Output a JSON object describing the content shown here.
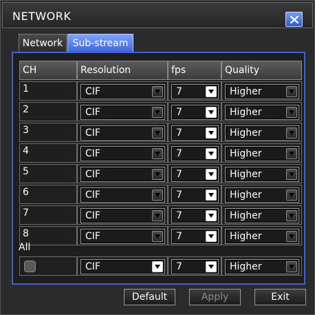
{
  "window": {
    "title": "NETWORK"
  },
  "tabs": [
    {
      "label": "Network",
      "active": false
    },
    {
      "label": "Sub-stream",
      "active": true
    }
  ],
  "table": {
    "headers": [
      "CH",
      "Resolution",
      "fps",
      "Quality"
    ],
    "rows": [
      {
        "ch": "1",
        "resolution": "CIF",
        "fps": "7",
        "quality": "Higher"
      },
      {
        "ch": "2",
        "resolution": "CIF",
        "fps": "7",
        "quality": "Higher"
      },
      {
        "ch": "3",
        "resolution": "CIF",
        "fps": "7",
        "quality": "Higher"
      },
      {
        "ch": "4",
        "resolution": "CIF",
        "fps": "7",
        "quality": "Higher"
      },
      {
        "ch": "5",
        "resolution": "CIF",
        "fps": "7",
        "quality": "Higher"
      },
      {
        "ch": "6",
        "resolution": "CIF",
        "fps": "7",
        "quality": "Higher"
      },
      {
        "ch": "7",
        "resolution": "CIF",
        "fps": "7",
        "quality": "Higher"
      },
      {
        "ch": "8",
        "resolution": "CIF",
        "fps": "7",
        "quality": "Higher"
      }
    ]
  },
  "all": {
    "label": "All",
    "checked": false,
    "resolution": "CIF",
    "fps": "7",
    "quality": "Higher"
  },
  "buttons": {
    "default": "Default",
    "apply": "Apply",
    "exit": "Exit"
  },
  "colors": {
    "accent": "#3e63d8",
    "tab_active": "#6f93f5",
    "background": "#2b2b2b"
  },
  "icons": {
    "close": "close-x-icon",
    "dropdown": "chevron-down-icon"
  }
}
